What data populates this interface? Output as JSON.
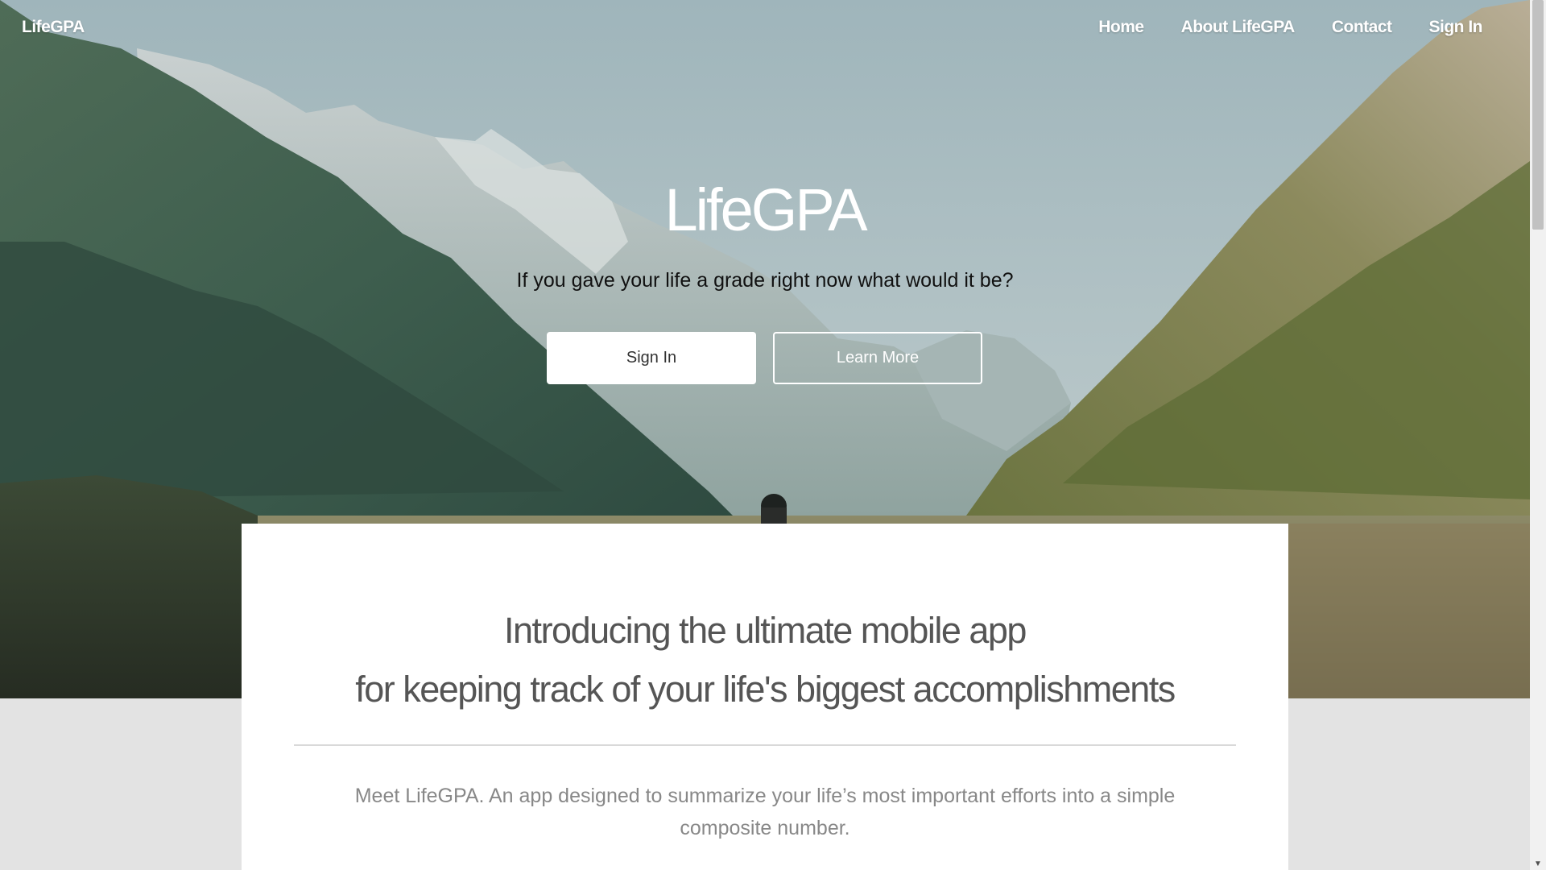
{
  "nav": {
    "brand": "LifeGPA",
    "links": [
      "Home",
      "About LifeGPA",
      "Contact",
      "Sign In"
    ]
  },
  "hero": {
    "title": "LifeGPA",
    "tagline": "If you gave your life a grade right now what would it be?",
    "sign_in_label": "Sign In",
    "learn_more_label": "Learn More",
    "background": "mountain-lake-photo"
  },
  "intro": {
    "line1": "Introducing the ultimate mobile app",
    "line2": "for keeping track of your life's biggest accomplishments",
    "description": "Meet LifeGPA. An app designed to summarize your life’s most important efforts into a simple composite number."
  },
  "scrollbar": {
    "down_arrow": "▼"
  }
}
